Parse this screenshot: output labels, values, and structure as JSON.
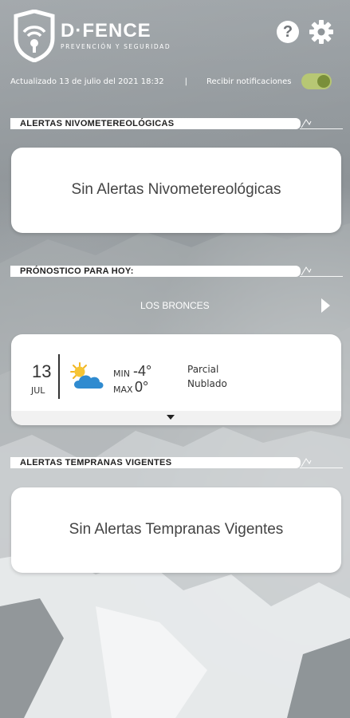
{
  "app": {
    "brand": "D·FENCE",
    "tagline": "PREVENCIÓN Y SEGURIDAD"
  },
  "header": {
    "help_icon": "question-circle-icon",
    "settings_icon": "gear-icon",
    "help_label": "?"
  },
  "status": {
    "updated": "Actualizado 13 de julio del 2021 18:32",
    "separator": "|",
    "notifications_label": "Recibir notificaciones",
    "notifications_enabled": true
  },
  "sections": {
    "snow_alerts": {
      "title": "ALERTAS NIVOMETEREOLÓGICAS",
      "message": "Sin Alertas Nivometereológicas"
    },
    "forecast": {
      "title": "PRÓNOSTICO PARA HOY:",
      "location": "LOS BRONCES",
      "day": "13",
      "month": "JUL",
      "weather_icon": "partly-cloudy-icon",
      "min_label": "MIN",
      "min_value": "-4°",
      "max_label": "MAX",
      "max_value": "0°",
      "condition_line1": "Parcial",
      "condition_line2": "Nublado"
    },
    "early_alerts": {
      "title": "ALERTAS TEMPRANAS VIGENTES",
      "message": "Sin Alertas Tempranas Vigentes"
    }
  },
  "colors": {
    "toggle_on": "#b7c774",
    "card_bg": "#ffffff",
    "text_dark": "#333333"
  }
}
